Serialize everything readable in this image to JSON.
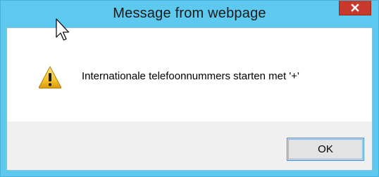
{
  "dialog": {
    "title": "Message from webpage",
    "message": "Internationale telefoonnummers starten met '+'",
    "ok_label": "OK",
    "icon": "warning-icon",
    "close_icon": "close-icon"
  },
  "colors": {
    "titlebar": "#5ec9ef",
    "close_button": "#c7392b",
    "button_area": "#f0f0f0",
    "ok_border": "#3c8bd6"
  }
}
